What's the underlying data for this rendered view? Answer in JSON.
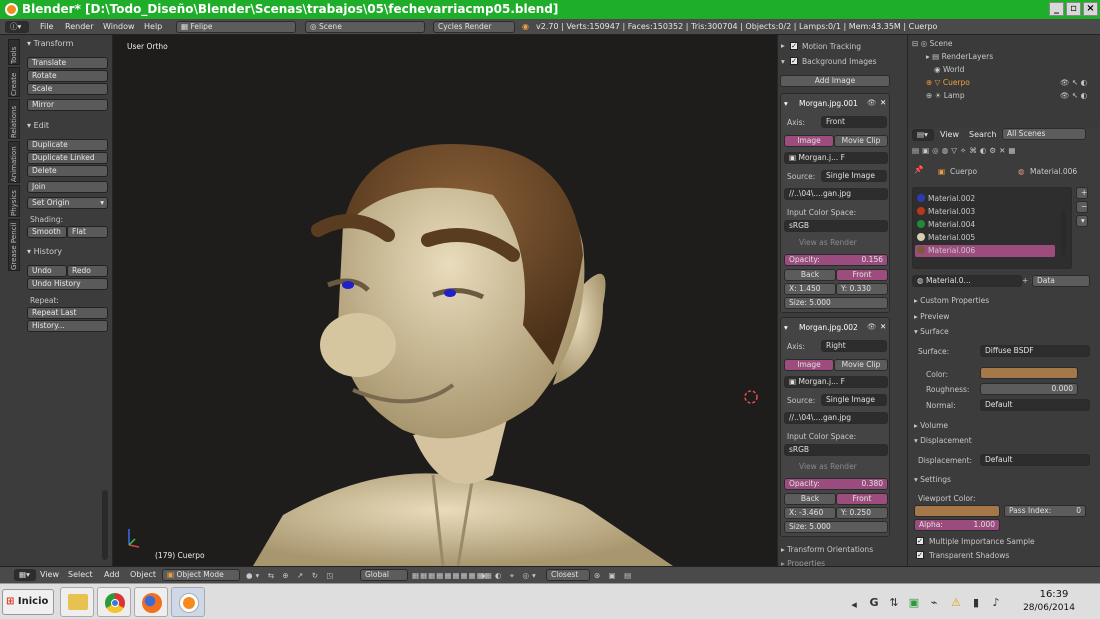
{
  "window": {
    "title": "Blender* [D:\\Todo_Diseño\\Blender\\Scenas\\trabajos\\05\\fechevarriacmp05.blend]"
  },
  "menubar": {
    "items": [
      "File",
      "Render",
      "Window",
      "Help"
    ],
    "screen": "Felipe",
    "scene": "Scene",
    "engine": "Cycles Render",
    "stats": "v2.70 | Verts:150947 | Faces:150352 | Tris:300704 | Objects:0/2 | Lamps:0/1 | Mem:43.35M | Cuerpo"
  },
  "toolshelf": {
    "tabs": [
      "Tools",
      "Create",
      "Relations",
      "Animation",
      "Physics",
      "Grease Pencil"
    ],
    "transform": {
      "header": "Transform",
      "buttons": [
        "Translate",
        "Rotate",
        "Scale",
        "Mirror"
      ]
    },
    "edit": {
      "header": "Edit",
      "buttons": [
        "Duplicate",
        "Duplicate Linked",
        "Delete",
        "Join",
        "Set Origin"
      ],
      "shading_label": "Shading:",
      "smooth": "Smooth",
      "flat": "Flat"
    },
    "history": {
      "header": "History",
      "undo": "Undo",
      "redo": "Redo",
      "undo_history": "Undo History",
      "repeat_label": "Repeat:",
      "repeat_last": "Repeat Last",
      "history": "History..."
    }
  },
  "viewport": {
    "view_label": "User Ortho",
    "object_label": "(179) Cuerpo"
  },
  "npanel": {
    "motion_tracking": "Motion Tracking",
    "background_images": "Background Images",
    "add_image": "Add Image",
    "images": [
      {
        "name": "Morgan.jpg.001",
        "axis_label": "Axis:",
        "axis": "Front",
        "tab_image": "Image",
        "tab_clip": "Movie Clip",
        "file": "Morgan.j...",
        "f": "F",
        "source_label": "Source:",
        "source": "Single Image",
        "path": "//..\\04\\....gan.jpg",
        "ics_label": "Input Color Space:",
        "ics": "sRGB",
        "view_render": "View as Render",
        "opacity_label": "Opacity:",
        "opacity": "0.156",
        "back": "Back",
        "front": "Front",
        "x": "X: 1.450",
        "y": "Y: 0.330",
        "size": "Size: 5.000"
      },
      {
        "name": "Morgan.jpg.002",
        "axis_label": "Axis:",
        "axis": "Right",
        "tab_image": "Image",
        "tab_clip": "Movie Clip",
        "file": "Morgan.j...",
        "f": "F",
        "source_label": "Source:",
        "source": "Single Image",
        "path": "//..\\04\\....gan.jpg",
        "ics_label": "Input Color Space:",
        "ics": "sRGB",
        "view_render": "View as Render",
        "opacity_label": "Opacity:",
        "opacity": "0.380",
        "back": "Back",
        "front": "Front",
        "x": "X: -3.460",
        "y": "Y: 0.250",
        "size": "Size: 5.000"
      }
    ],
    "transform_orientations": "Transform Orientations",
    "properties": "Properties"
  },
  "outliner": {
    "items": [
      "Scene",
      "RenderLayers",
      "World",
      "Cuerpo",
      "Lamp"
    ]
  },
  "props": {
    "view": "View",
    "search": "Search",
    "all_scenes": "All Scenes",
    "object": "Cuerpo",
    "material": "Material.006",
    "materials": [
      {
        "name": "Material.002",
        "color": "#2c3bb2"
      },
      {
        "name": "Material.003",
        "color": "#b8381c"
      },
      {
        "name": "Material.004",
        "color": "#1f8a3a"
      },
      {
        "name": "Material.005",
        "color": "#d8cfb0"
      },
      {
        "name": "Material.006",
        "color": "#7c5a3a"
      }
    ],
    "mat_field": "Material.0...",
    "data": "Data",
    "custom_properties": "Custom Properties",
    "preview": "Preview",
    "surface": "Surface",
    "surface_label": "Surface:",
    "surface_value": "Diffuse BSDF",
    "color_label": "Color:",
    "color_value": "#a5784a",
    "roughness_label": "Roughness:",
    "roughness": "0.000",
    "normal_label": "Normal:",
    "normal": "Default",
    "volume": "Volume",
    "displacement": "Displacement",
    "displacement_label": "Displacement:",
    "displacement_value": "Default",
    "settings": "Settings",
    "viewport_color": "Viewport Color:",
    "pass_index": "Pass Index:",
    "pass_value": "0",
    "alpha": "Alpha:",
    "alpha_value": "1.000",
    "mis": "Multiple Importance Sample",
    "transparent_shadows": "Transparent Shadows"
  },
  "bottombar": {
    "view": "View",
    "select": "Select",
    "add": "Add",
    "object": "Object",
    "mode": "Object Mode",
    "orientation": "Global",
    "pivot": "Closest"
  },
  "taskbar": {
    "start": "Inicio",
    "time": "16:39",
    "date": "28/06/2014"
  }
}
